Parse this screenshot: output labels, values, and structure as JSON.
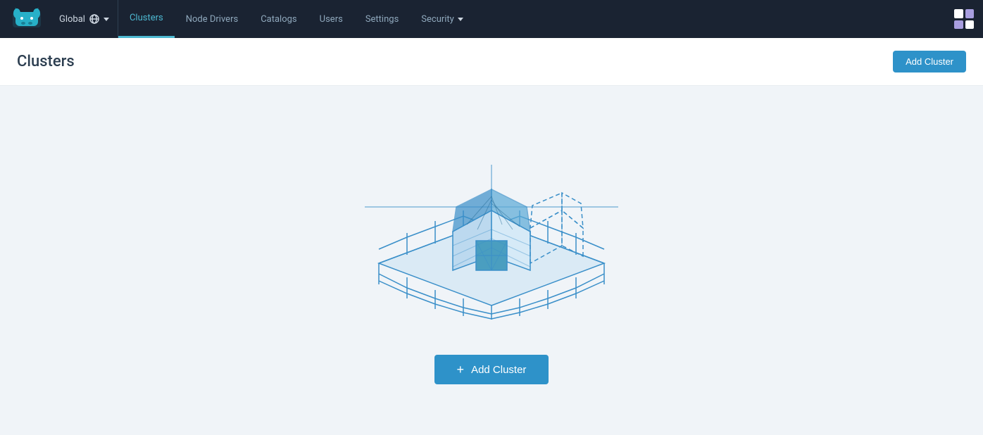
{
  "app": {
    "logo_alt": "Rancher logo"
  },
  "navbar": {
    "global_label": "Global",
    "links": [
      {
        "id": "clusters",
        "label": "Clusters",
        "active": true
      },
      {
        "id": "node-drivers",
        "label": "Node Drivers",
        "active": false
      },
      {
        "id": "catalogs",
        "label": "Catalogs",
        "active": false
      },
      {
        "id": "users",
        "label": "Users",
        "active": false
      },
      {
        "id": "settings",
        "label": "Settings",
        "active": false
      },
      {
        "id": "security",
        "label": "Security",
        "active": false,
        "has_chevron": true
      }
    ]
  },
  "page": {
    "title": "Clusters",
    "add_cluster_btn": "Add Cluster"
  },
  "empty_state": {
    "add_cluster_btn": "Add Cluster"
  }
}
